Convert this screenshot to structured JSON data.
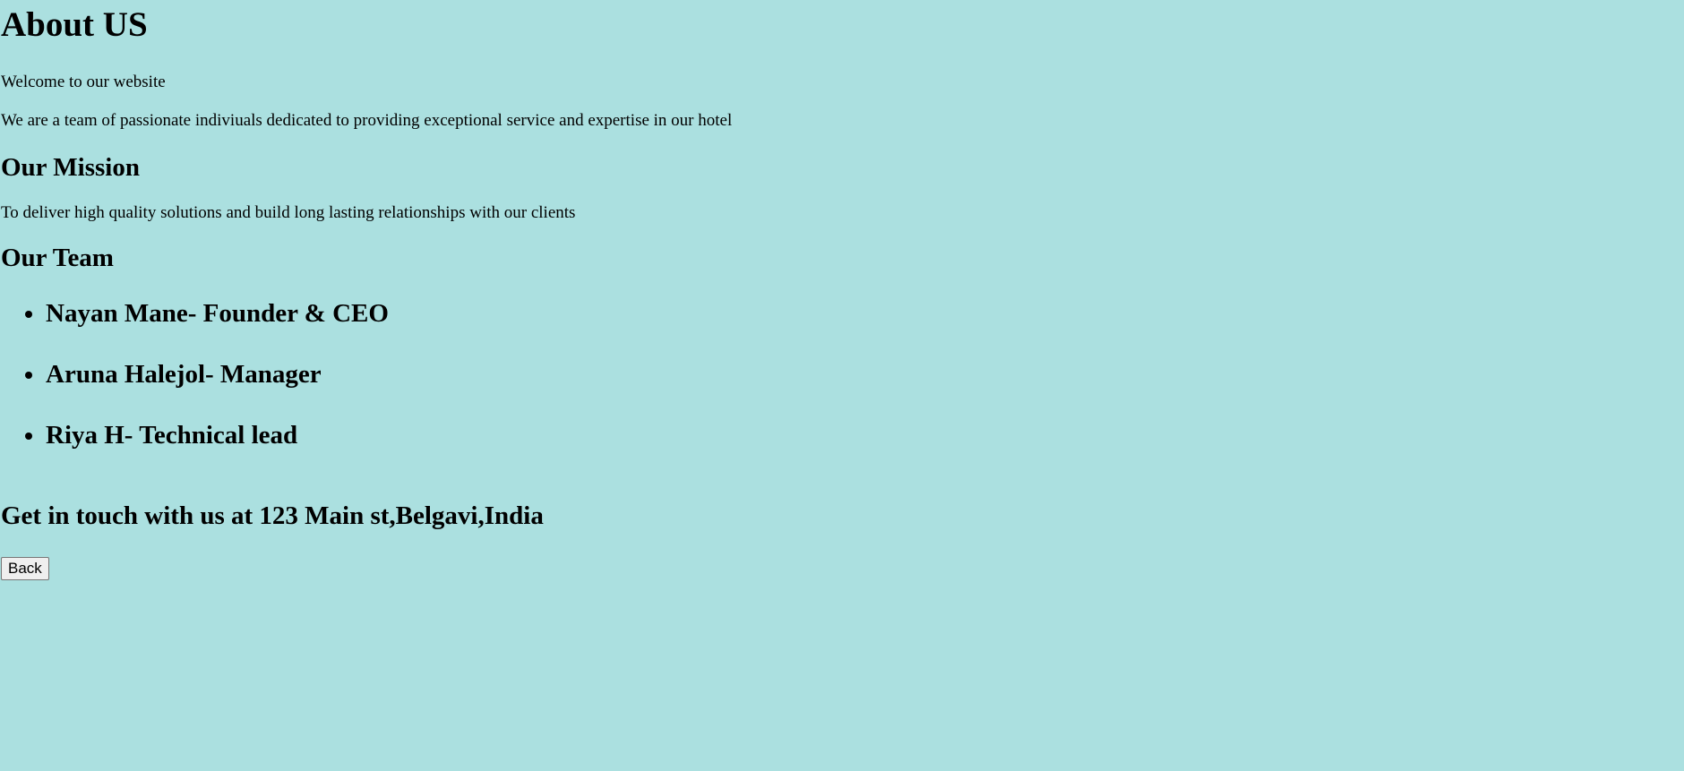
{
  "page": {
    "title": "About US",
    "welcome": "Welcome to our website",
    "intro": "We are a team of passionate indiviuals dedicated to providing exceptional service and expertise in our hotel",
    "mission_heading": "Our Mission",
    "mission_text": "To deliver high quality solutions and build long lasting relationships with our clients",
    "team_heading": "Our Team",
    "team": [
      "Nayan Mane- Founder & CEO",
      "Aruna Halejol- Manager",
      "Riya H- Technical lead"
    ],
    "contact": "Get in touch with us at 123 Main st,Belgavi,India",
    "back_label": "Back"
  },
  "colors": {
    "background": "#abe0e0",
    "text": "#000000"
  }
}
